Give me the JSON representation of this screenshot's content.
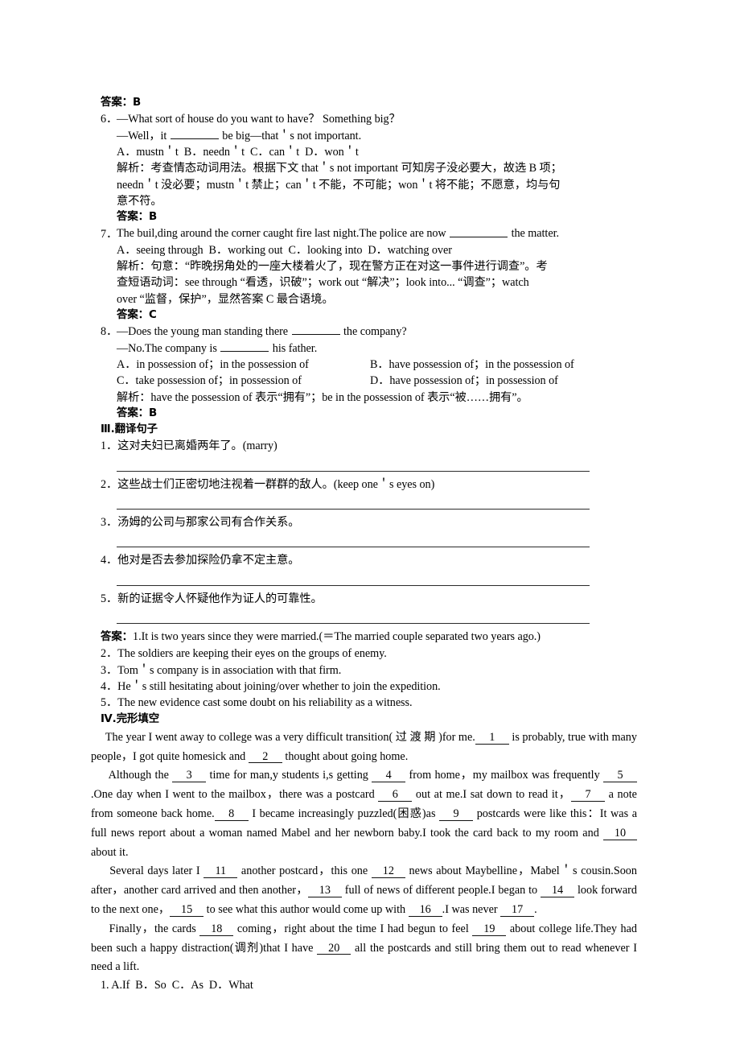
{
  "document": {
    "language": "zh-CN + en",
    "page_type": "english-exercise-worksheet"
  },
  "labels": {
    "answer": "答案：",
    "analysis": "解析：",
    "answer_b": "答案：B",
    "answer_c": "答案：C"
  },
  "top_answer": "答案：B",
  "questions": [
    {
      "number": "6．",
      "stem_line1": "—What sort of house do you want to have？ Something big？",
      "stem_line2_a": "—Well，it ",
      "stem_line2_b": " be big—that＇s not important.",
      "options": "A．mustn＇t  B．needn＇t  C．can＇t  D．won＇t",
      "analysis_lines": [
        "解析：考查情态动词用法。根据下文 that＇s not important 可知房子没必要大，故选 B 项；",
        "needn＇t 没必要；mustn＇t 禁止；can＇t 不能，不可能；won＇t 将不能；不愿意，均与句",
        "意不符。"
      ],
      "answer": "答案：B"
    },
    {
      "number": "7．",
      "stem_line1_a": "The buil,ding around the corner caught fire last night.The police are now ",
      "stem_line1_b": " the matter.",
      "options": "A．seeing through  B．working out  C．looking into  D．watching over",
      "analysis_lines": [
        "解析：句意：“昨晚拐角处的一座大楼着火了，现在警方正在对这一事件进行调查”。考",
        "查短语动词：see through “看透，识破”；work out “解决”；look into... “调查”；watch",
        "over “监督，保护”，显然答案 C 最合语境。"
      ],
      "answer": "答案：C"
    },
    {
      "number": "8．",
      "stem_line1_a": "—Does the young man standing there ",
      "stem_line1_b": " the company?",
      "stem_line2_a": "—No.The company is ",
      "stem_line2_b": " his father.",
      "option_ac": "A．in possession of；in the possession of",
      "option_bd": "B．have possession of；in the possession of",
      "option_c": "C．take possession of；in possession of",
      "option_d": "D．have possession of；in possession of",
      "analysis_lines": [
        "解析：have the possession of 表示“拥有”；be in the possession of 表示“被……拥有”。"
      ],
      "answer": "答案：B"
    }
  ],
  "section_translation": {
    "heading": "Ⅲ.翻译句子",
    "items": [
      "1．这对夫妇已离婚两年了。(marry)",
      "2．这些战士们正密切地注视着一群群的敌人。(keep one＇s eyes on)",
      "3．汤姆的公司与那家公司有合作关系。",
      "4．他对是否去参加探险仍拿不定主意。",
      "5．新的证据令人怀疑他作为证人的可靠性。"
    ],
    "answers_label": "答案：",
    "answers": [
      "1.It is two years since they were married.(＝The married couple separated two years ago.)",
      "2．The soldiers are keeping their eyes on the groups of enemy.",
      "3．Tom＇s company is in association with that firm.",
      "4．He＇s still hesitating about joining/over whether to join the expedition.",
      "5．The new evidence cast some doubt on his reliability as a witness."
    ]
  },
  "section_cloze": {
    "heading": "Ⅳ.完形填空",
    "paragraphs": [
      {
        "id": "p1",
        "segments": [
          {
            "t": "The year I went away to college was a very difficult transition( 过 渡 期 )for me."
          },
          {
            "blank": "1"
          },
          {
            "t": " is probably, true with many people，I got quite homesick and "
          },
          {
            "blank": "2"
          },
          {
            "t": " thought about going home."
          }
        ]
      },
      {
        "id": "p2",
        "segments": [
          {
            "t": "Although the "
          },
          {
            "blank": "3"
          },
          {
            "t": " time for man,y students i,s getting "
          },
          {
            "blank": "4"
          },
          {
            "t": " from home，my mailbox was frequently "
          },
          {
            "blank": "5"
          },
          {
            "t": ".One day when I went to the mailbox，there was a postcard "
          },
          {
            "blank": "6"
          },
          {
            "t": " out at me.I sat down to read it，"
          },
          {
            "blank": "7"
          },
          {
            "t": " a note from someone back home."
          },
          {
            "blank": "8"
          },
          {
            "t": " I became increasingly puzzled(困惑)as "
          },
          {
            "blank": "9"
          },
          {
            "t": " postcards were like this：It was a full news report about a woman named Mabel and her newborn baby.I took the card back to my room and "
          },
          {
            "blank": "10"
          },
          {
            "t": " about it."
          }
        ]
      },
      {
        "id": "p3",
        "segments": [
          {
            "t": "Several days later I "
          },
          {
            "blank": "11"
          },
          {
            "t": " another postcard，this one "
          },
          {
            "blank": "12"
          },
          {
            "t": " news about Maybelline，Mabel＇s cousin.Soon after，another card arrived and then another，"
          },
          {
            "blank": "13"
          },
          {
            "t": " full of news of different people.I began to "
          },
          {
            "blank": "14"
          },
          {
            "t": " look forward to the next one，"
          },
          {
            "blank": "15"
          },
          {
            "t": " to see what this author would come up with "
          },
          {
            "blank": "16"
          },
          {
            "t": ".I was never "
          },
          {
            "blank": "17"
          },
          {
            "t": "."
          }
        ]
      },
      {
        "id": "p4",
        "segments": [
          {
            "t": "Finally，the cards "
          },
          {
            "blank": "18"
          },
          {
            "t": " coming，right about the time I had begun to feel "
          },
          {
            "blank": "19"
          },
          {
            "t": " about college life.They had been such a happy distraction(调剂)that I have "
          },
          {
            "blank": "20"
          },
          {
            "t": " all the postcards and still bring them out to read whenever I need a lift."
          }
        ]
      }
    ],
    "options": [
      "1. A.If  B．So  C．As  D．What"
    ]
  }
}
